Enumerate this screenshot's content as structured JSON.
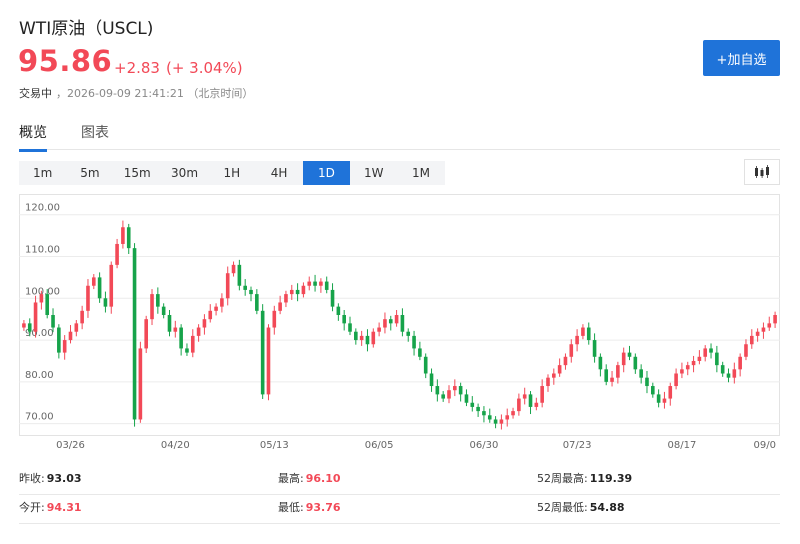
{
  "header": {
    "title": "WTI原油（USCL)",
    "price": "95.86",
    "change": "+2.83",
    "change_pct": "(+ 3.04%)",
    "status": "交易中",
    "datetime": "，2026-09-09 21:41:21 （北京时间）",
    "add_button": "+加自选"
  },
  "tabs": [
    {
      "label": "概览",
      "active": true
    },
    {
      "label": "图表",
      "active": false
    }
  ],
  "periods": [
    "1m",
    "5m",
    "15m",
    "30m",
    "1H",
    "4H",
    "1D",
    "1W",
    "1M"
  ],
  "active_period": "1D",
  "colors": {
    "up": "#f24957",
    "down": "#16a34a",
    "accent": "#1f73d9"
  },
  "chart_data": {
    "type": "candlestick",
    "yticks": [
      "120.00",
      "110.00",
      "100.00",
      "90.00",
      "80.00",
      "70.00"
    ],
    "ylim": [
      68,
      124
    ],
    "xticks": [
      {
        "label": "03/26",
        "index": 8
      },
      {
        "label": "04/20",
        "index": 26
      },
      {
        "label": "05/13",
        "index": 43
      },
      {
        "label": "06/05",
        "index": 61
      },
      {
        "label": "06/30",
        "index": 79
      },
      {
        "label": "07/23",
        "index": 95
      },
      {
        "label": "08/17",
        "index": 113
      },
      {
        "label": "09/0",
        "index": 130
      }
    ],
    "closes": [
      94,
      92,
      99,
      101,
      96,
      93,
      87,
      90,
      92,
      94,
      97,
      103,
      105,
      100,
      98,
      108,
      113,
      117,
      112,
      71,
      88,
      95,
      101,
      98,
      96,
      92,
      93,
      88,
      87,
      91,
      93,
      95,
      97,
      98,
      100,
      106,
      108,
      103,
      102,
      101,
      97,
      77,
      93,
      97,
      99,
      101,
      102,
      101,
      103,
      104,
      103,
      104,
      102,
      98,
      96,
      94,
      92,
      90,
      91,
      89,
      92,
      93,
      95,
      94,
      96,
      92,
      91,
      88,
      86,
      82,
      79,
      77,
      76,
      78,
      79,
      77,
      75,
      74,
      73,
      72,
      71,
      70,
      71,
      72,
      73,
      76,
      77,
      74,
      75,
      79,
      81,
      82,
      84,
      86,
      89,
      91,
      93,
      90,
      86,
      83,
      80,
      81,
      84,
      87,
      86,
      83,
      81,
      79,
      77,
      75,
      76,
      79,
      82,
      83,
      84,
      85,
      86,
      88,
      87,
      84,
      82,
      81,
      83,
      86,
      89,
      91,
      92,
      93,
      94,
      96
    ],
    "high": "96.10",
    "low": "93.76"
  },
  "stats": {
    "rows": [
      [
        {
          "label": "昨收:",
          "value": "93.03",
          "color": "dark"
        },
        {
          "label": "最高:",
          "value": "96.10",
          "color": "red"
        },
        {
          "label": "52周最高:",
          "value": "119.39",
          "color": "dark"
        }
      ],
      [
        {
          "label": "今开:",
          "value": "94.31",
          "color": "red"
        },
        {
          "label": "最低:",
          "value": "93.76",
          "color": "red"
        },
        {
          "label": "52周最低:",
          "value": "54.88",
          "color": "dark"
        }
      ]
    ]
  }
}
